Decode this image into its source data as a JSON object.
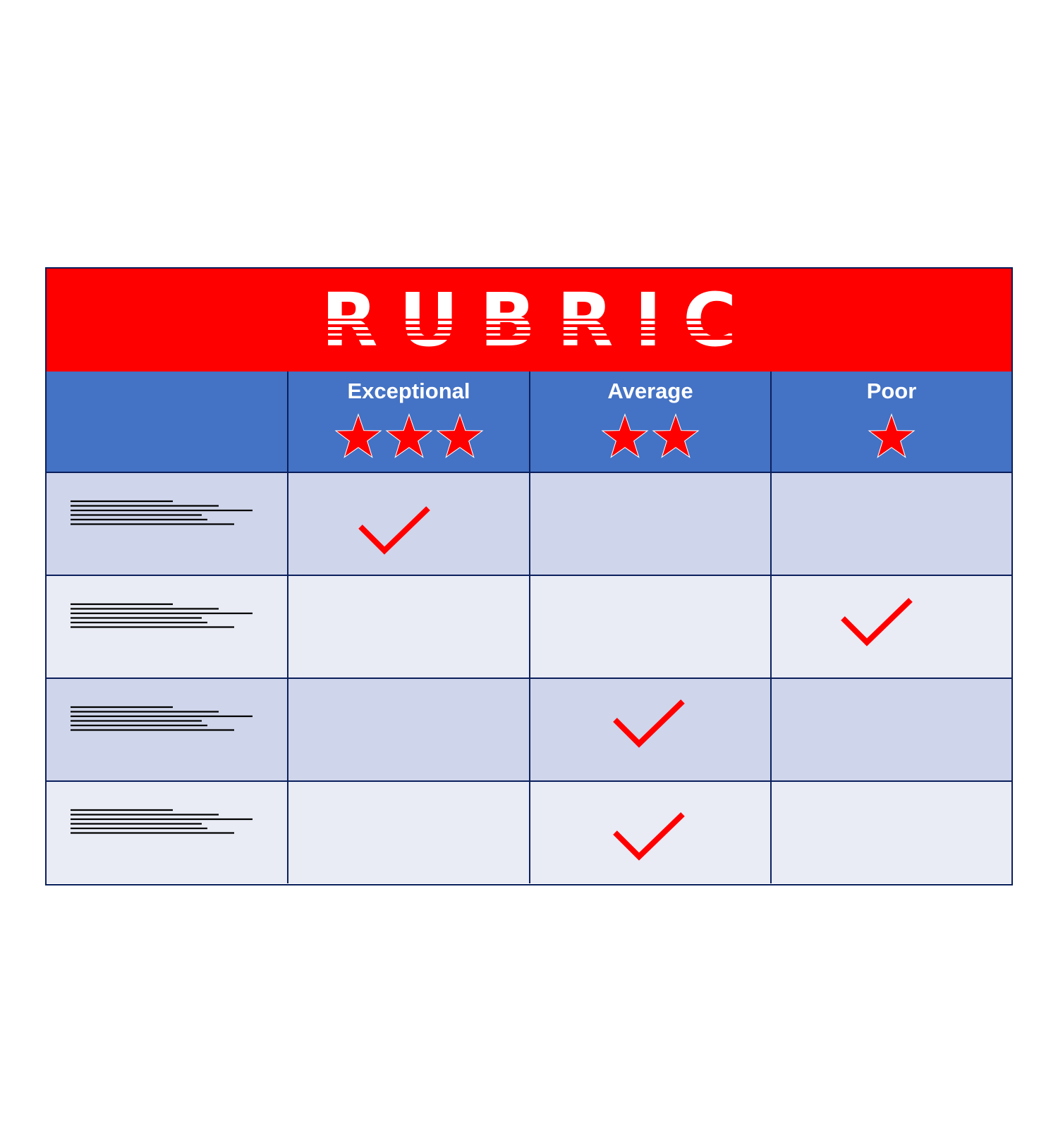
{
  "title": "RUBRIC",
  "colors": {
    "red": "#ff0000",
    "blue": "#4472c4",
    "row_dark": "#cfd5ea",
    "row_light": "#e9ebf5",
    "border": "#0a1f5c"
  },
  "columns": [
    {
      "label": "",
      "stars": 0
    },
    {
      "label": "Exceptional",
      "stars": 3
    },
    {
      "label": "Average",
      "stars": 2
    },
    {
      "label": "Poor",
      "stars": 1
    }
  ],
  "rows": [
    {
      "checked_column": "Exceptional"
    },
    {
      "checked_column": "Poor"
    },
    {
      "checked_column": "Average"
    },
    {
      "checked_column": "Average"
    }
  ],
  "icons": {
    "star": "star-icon",
    "check": "checkmark-icon",
    "placeholder_text": "text-lines-icon"
  }
}
